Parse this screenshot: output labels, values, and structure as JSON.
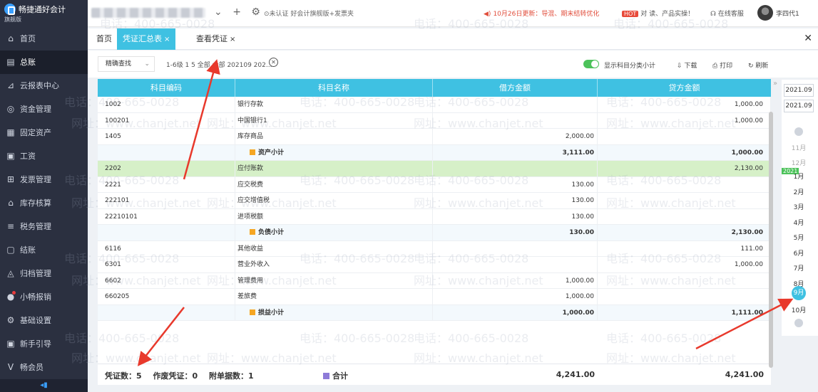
{
  "app": {
    "name": "畅捷通好会计",
    "edition": "旗舰版"
  },
  "topbar": {
    "unverified": "未认证",
    "edition_promo": "好会计旗舰版+发票夹",
    "notice": "10月26日更新：导混、期末结转优化",
    "promo": "对 读、产品实操！",
    "promo_badge": "HOT",
    "service": "在线客服",
    "username": "李四代1"
  },
  "sidebar": {
    "items": [
      {
        "label": "首页",
        "icon": "home-icon",
        "glyph": "⌂"
      },
      {
        "label": "总账",
        "icon": "ledger-icon",
        "glyph": "▤"
      },
      {
        "label": "云报表中心",
        "icon": "chart-icon",
        "glyph": "⊿"
      },
      {
        "label": "资金管理",
        "icon": "money-icon",
        "glyph": "◎"
      },
      {
        "label": "固定资产",
        "icon": "asset-icon",
        "glyph": "▦"
      },
      {
        "label": "工资",
        "icon": "salary-icon",
        "glyph": "▣"
      },
      {
        "label": "发票管理",
        "icon": "invoice-icon",
        "glyph": "⊞"
      },
      {
        "label": "库存核算",
        "icon": "warehouse-icon",
        "glyph": "⌂"
      },
      {
        "label": "税务管理",
        "icon": "tax-icon",
        "glyph": "≡"
      },
      {
        "label": "结账",
        "icon": "close-period-icon",
        "glyph": "▢"
      },
      {
        "label": "归档管理",
        "icon": "archive-icon",
        "glyph": "◬"
      },
      {
        "label": "小畅报销",
        "icon": "reimburse-icon",
        "glyph": "●"
      },
      {
        "label": "基础设置",
        "icon": "settings-icon",
        "glyph": "⚙"
      },
      {
        "label": "新手引导",
        "icon": "guide-icon",
        "glyph": "▣"
      },
      {
        "label": "畅会员",
        "icon": "vip-icon",
        "glyph": "V"
      }
    ],
    "active_index": 1,
    "collapse_glyph": "◂▮"
  },
  "tabs": [
    {
      "label": "首页",
      "closable": false
    },
    {
      "label": "凭证汇总表",
      "closable": true,
      "active": true
    },
    {
      "label": "查看凭证",
      "closable": true
    }
  ],
  "toolbar": {
    "filter_mode": "精确查找",
    "filter_value": "1-6级 1 5 全部 全部 202109 202...",
    "toggle_label": "显示科目分类小计",
    "download": "下载",
    "print": "打印",
    "refresh": "刷新"
  },
  "table": {
    "headers": [
      "科目编码",
      "科目名称",
      "借方金额",
      "贷方金额"
    ],
    "rows": [
      {
        "code": "1002",
        "name": "银行存款",
        "debit": "",
        "credit": "1,000.00"
      },
      {
        "code": "100201",
        "name": "中国银行1",
        "debit": "",
        "credit": "1,000.00"
      },
      {
        "code": "1405",
        "name": "库存商品",
        "debit": "2,000.00",
        "credit": ""
      },
      {
        "code": "",
        "name": "资产小计",
        "debit": "3,111.00",
        "credit": "1,000.00",
        "type": "subtotal"
      },
      {
        "code": "2202",
        "name": "应付账款",
        "debit": "",
        "credit": "2,130.00",
        "type": "selected"
      },
      {
        "code": "2221",
        "name": "应交税费",
        "debit": "130.00",
        "credit": ""
      },
      {
        "code": "222101",
        "name": "应交增值税",
        "debit": "130.00",
        "credit": ""
      },
      {
        "code": "22210101",
        "name": "进项税额",
        "debit": "130.00",
        "credit": ""
      },
      {
        "code": "",
        "name": "负债小计",
        "debit": "130.00",
        "credit": "2,130.00",
        "type": "subtotal"
      },
      {
        "code": "6116",
        "name": "其他收益",
        "debit": "",
        "credit": "111.00"
      },
      {
        "code": "6301",
        "name": "营业外收入",
        "debit": "",
        "credit": "1,000.00"
      },
      {
        "code": "6602",
        "name": "管理费用",
        "debit": "1,000.00",
        "credit": ""
      },
      {
        "code": "660205",
        "name": "差旅费",
        "debit": "1,000.00",
        "credit": ""
      },
      {
        "code": "",
        "name": "损益小计",
        "debit": "1,000.00",
        "credit": "1,111.00",
        "type": "subtotal"
      }
    ],
    "footer": {
      "voucher_count": "凭证数：5",
      "void_count": "作废凭证：0",
      "attachment_count": "附单据数：1",
      "total_label": "合计",
      "total_debit": "4,241.00",
      "total_credit": "4,241.00"
    }
  },
  "period_panel": {
    "start": "2021.09",
    "end": "2021.09",
    "year_badge": "2021",
    "months_before": [
      "11月",
      "12月"
    ],
    "months": [
      "1月",
      "2月",
      "3月",
      "4月",
      "5月",
      "6月",
      "7月",
      "8月"
    ],
    "active_month": "9月",
    "months_after": [
      "10月"
    ]
  },
  "watermark": {
    "phone": "电话：400-665-0028",
    "site": "网址：www.chanjet.net"
  },
  "colors": {
    "accent": "#3fc1e2",
    "sidebar": "#2b3040",
    "toggle": "#4cc25a",
    "selected_row": "#d6f0c8",
    "annotation_arrow": "#e8392c"
  }
}
